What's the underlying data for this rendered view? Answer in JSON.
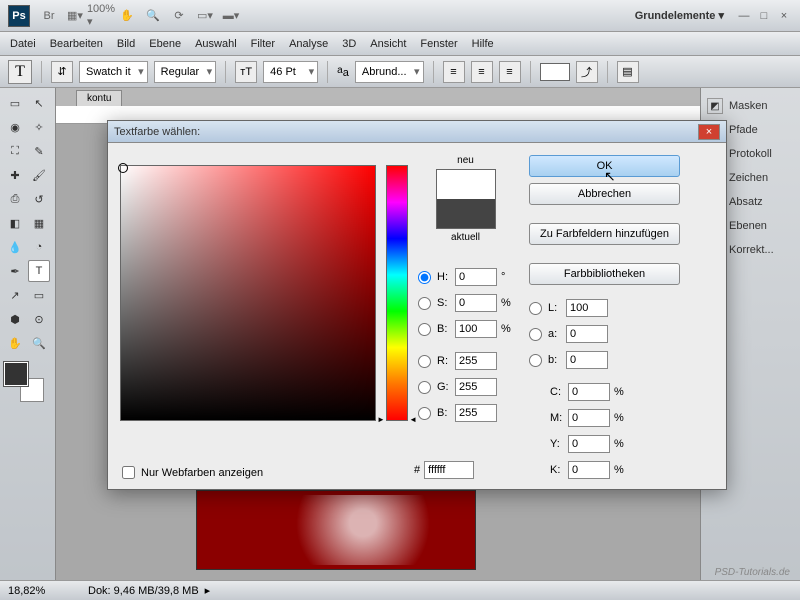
{
  "app": {
    "workspace": "Grundelemente ▾"
  },
  "menu": [
    "Datei",
    "Bearbeiten",
    "Bild",
    "Ebene",
    "Auswahl",
    "Filter",
    "Analyse",
    "3D",
    "Ansicht",
    "Fenster",
    "Hilfe"
  ],
  "options": {
    "font": "Swatch it",
    "style": "Regular",
    "size": "46 Pt",
    "aa": "Abrund..."
  },
  "tab": "kontu",
  "zoom": "18,82%",
  "docinfo": "Dok: 9,46 MB/39,8 MB",
  "panels": [
    "Masken",
    "Pfade",
    "Protokoll",
    "Zeichen",
    "Absatz",
    "Ebenen",
    "Korrekt..."
  ],
  "panel_icons": [
    "◩",
    "⬠",
    "≡",
    "A",
    "¶",
    "◈",
    "◐"
  ],
  "dialog": {
    "title": "Textfarbe wählen:",
    "neu": "neu",
    "aktuell": "aktuell",
    "ok": "OK",
    "cancel": "Abbrechen",
    "addto": "Zu Farbfeldern hinzufügen",
    "libs": "Farbbibliotheken",
    "webonly": "Nur Webfarben anzeigen",
    "hex": "ffffff",
    "vals": {
      "H": {
        "v": "0",
        "u": "°"
      },
      "S": {
        "v": "0",
        "u": "%"
      },
      "B": {
        "v": "100",
        "u": "%"
      },
      "R": {
        "v": "255",
        "u": ""
      },
      "G": {
        "v": "255",
        "u": ""
      },
      "B2": {
        "v": "255",
        "u": ""
      },
      "L": {
        "v": "100",
        "u": ""
      },
      "a": {
        "v": "0",
        "u": ""
      },
      "b": {
        "v": "0",
        "u": ""
      },
      "C": {
        "v": "0",
        "u": "%"
      },
      "M": {
        "v": "0",
        "u": "%"
      },
      "Y": {
        "v": "0",
        "u": "%"
      },
      "K": {
        "v": "0",
        "u": "%"
      }
    }
  },
  "watermark": "PSD-Tutorials.de"
}
